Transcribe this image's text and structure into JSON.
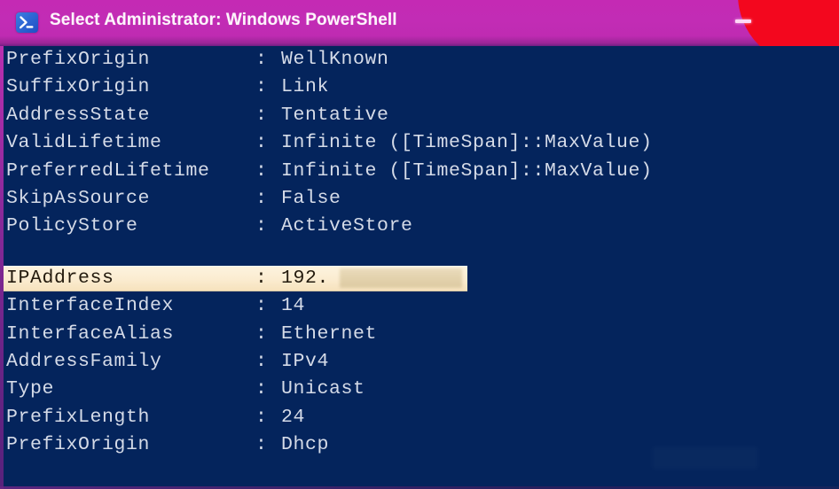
{
  "window": {
    "title": "Select Administrator: Windows PowerShell",
    "app_icon": "powershell-icon",
    "titlebar_color": "#c22cb5",
    "accent_blob_color": "#f3071e",
    "terminal_background": "#04245c",
    "terminal_foreground": "#d5dbe8",
    "selection_background": "#fbecd0",
    "selection_foreground": "#241b0e"
  },
  "titlebar": {
    "minimize_label": "–",
    "minimize_name": "minimize-button"
  },
  "terminal": {
    "separator": ":",
    "lines": [
      {
        "label": "PrefixOrigin",
        "value": "WellKnown",
        "highlight": false
      },
      {
        "label": "SuffixOrigin",
        "value": "Link",
        "highlight": false
      },
      {
        "label": "AddressState",
        "value": "Tentative",
        "highlight": false
      },
      {
        "label": "ValidLifetime",
        "value": "Infinite ([TimeSpan]::MaxValue)",
        "highlight": false
      },
      {
        "label": "PreferredLifetime",
        "value": "Infinite ([TimeSpan]::MaxValue)",
        "highlight": false
      },
      {
        "label": "SkipAsSource",
        "value": "False",
        "highlight": false
      },
      {
        "label": "PolicyStore",
        "value": "ActiveStore",
        "highlight": false
      },
      {
        "label": "",
        "value": "",
        "spacer": true
      },
      {
        "label": "IPAddress",
        "value": "192.",
        "highlight": true,
        "redacted": true
      },
      {
        "label": "InterfaceIndex",
        "value": "14",
        "highlight": false
      },
      {
        "label": "InterfaceAlias",
        "value": "Ethernet",
        "highlight": false
      },
      {
        "label": "AddressFamily",
        "value": "IPv4",
        "highlight": false
      },
      {
        "label": "Type",
        "value": "Unicast",
        "highlight": false
      },
      {
        "label": "PrefixLength",
        "value": "24",
        "highlight": false
      },
      {
        "label": "PrefixOrigin",
        "value": "Dhcp",
        "highlight": false
      }
    ]
  }
}
